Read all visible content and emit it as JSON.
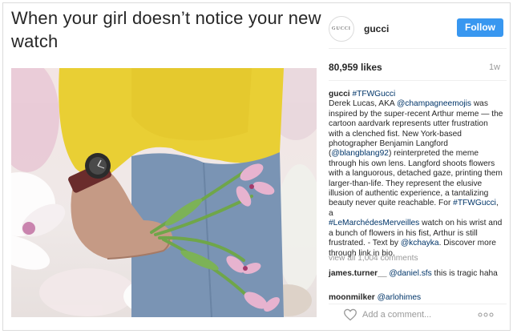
{
  "meme": {
    "caption": "When your girl doesn’t notice your new watch"
  },
  "post": {
    "avatar_text": "GUCCI",
    "username": "gucci",
    "follow_label": "Follow",
    "likes": "80,959 likes",
    "time": "1w"
  },
  "caption": {
    "username": "gucci",
    "hashtag_title": "#TFWGucci",
    "t1": "Derek Lucas, AKA ",
    "mention_1": "@champagneemojis",
    "t2": " was inspired by the super-recent Arthur meme — the cartoon aardvark represents utter frustration with a clenched fist. New York-based photographer Benjamin Langford (",
    "mention_2": "@blangblang92",
    "t3": ") reinterpreted the meme through his own lens. Langford shoots flowers with a languorous, detached gaze, printing them larger-than-life. They represent the elusive illusion of authentic experience, a tantalizing beauty never quite reachable. For ",
    "hashtag_2": "#TFWGucci",
    "t4": ", a ",
    "hashtag_3": "#LeMarchédesMerveilles",
    "t5": " watch on his wrist and a bunch of flowers in his fist, Arthur is still frustrated. - Text by ",
    "mention_3": "@kchayka",
    "t6": ". Discover more through link in bio."
  },
  "comments": {
    "view_all": "view all 1,004 comments",
    "c1_user": "james.turner__",
    "c1_mention": "@daniel.sfs",
    "c1_text": " this is tragic haha",
    "c2_user": "moonmilker",
    "c2_mention": "@arlohimes"
  },
  "add_comment": {
    "placeholder": "Add a comment..."
  },
  "icons": {
    "like": "heart-icon",
    "options": "more-options-icon"
  },
  "colors": {
    "follow_button": "#3897f0",
    "link": "#003569",
    "muted": "#999999"
  }
}
